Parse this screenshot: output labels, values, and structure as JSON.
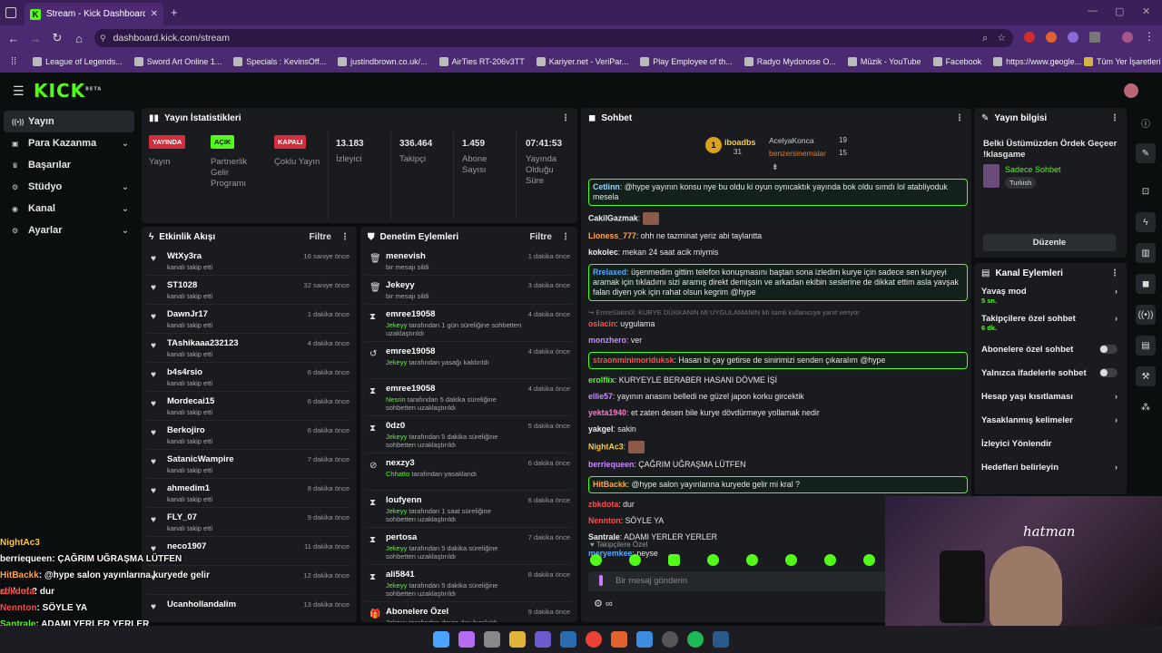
{
  "browser": {
    "tab_title": "Stream - Kick Dashboard",
    "url": "dashboard.kick.com/stream",
    "bookmarks": [
      "League of Legends...",
      "Sword Art Online 1...",
      "Specials : KevinsOff...",
      "justindbrown.co.uk/...",
      "AirTies RT-206v3TT",
      "Kariyer.net - VeriPar...",
      "Play Employee of th...",
      "Radyo Mydonose O...",
      "Müzik - YouTube",
      "Facebook",
      "https://www.google..."
    ],
    "all_bookmarks": "Tüm Yer İşaretleri"
  },
  "app": {
    "logo": "KICK",
    "logo_sup": "BETA"
  },
  "sidebar": {
    "items": [
      {
        "label": "Yayın",
        "chev": false
      },
      {
        "label": "Para Kazanma",
        "chev": true
      },
      {
        "label": "Başarılar",
        "chev": false
      },
      {
        "label": "Stüdyo",
        "chev": true
      },
      {
        "label": "Kanal",
        "chev": true
      },
      {
        "label": "Ayarlar",
        "chev": true
      }
    ]
  },
  "stats": {
    "title": "Yayın İstatistikleri",
    "s1": {
      "badge": "YAYINDA",
      "label": "Yayın"
    },
    "s2": {
      "badge": "AÇIK",
      "label": "Partnerlik Gelir Programı"
    },
    "s3": {
      "badge": "KAPALI",
      "label": "Çoklu Yayın"
    },
    "s4": {
      "value": "13.183",
      "label": "İzleyici"
    },
    "s5": {
      "value": "336.464",
      "label": "Takipçi"
    },
    "s6": {
      "value": "1.459",
      "label": "Abone Sayısı"
    },
    "s7": {
      "value": "07:41:53",
      "label": "Yayında Olduğu Süre"
    }
  },
  "activity": {
    "title": "Etkinlik Akışı",
    "filter": "Filtre",
    "rows": [
      {
        "name": "WtXy3ra",
        "sub": "kanalı takip etti",
        "time": "16 saniye önce"
      },
      {
        "name": "ST1028",
        "sub": "kanalı takip etti",
        "time": "32 saniye önce"
      },
      {
        "name": "DawnJr17",
        "sub": "kanalı takip etti",
        "time": "1 dakika önce"
      },
      {
        "name": "TAshikaaa232123",
        "sub": "kanalı takip etti",
        "time": "4 dakika önce"
      },
      {
        "name": "b4s4rsio",
        "sub": "kanalı takip etti",
        "time": "6 dakika önce"
      },
      {
        "name": "Mordecai15",
        "sub": "kanalı takip etti",
        "time": "6 dakika önce"
      },
      {
        "name": "Berkojiro",
        "sub": "kanalı takip etti",
        "time": "6 dakika önce"
      },
      {
        "name": "SatanicWampire",
        "sub": "kanalı takip etti",
        "time": "7 dakika önce"
      },
      {
        "name": "ahmedim1",
        "sub": "kanalı takip etti",
        "time": "8 dakika önce"
      },
      {
        "name": "FLY_07",
        "sub": "kanalı takip etti",
        "time": "9 dakika önce"
      },
      {
        "name": "neco1907",
        "sub": "",
        "time": "11 dakika önce"
      },
      {
        "name": "",
        "sub": "",
        "time": "12 dakika önce"
      },
      {
        "name": "Ucanhollandalim",
        "sub": "",
        "time": "13 dakika önce"
      }
    ]
  },
  "moderation": {
    "title": "Denetim Eylemleri",
    "filter": "Filtre",
    "rows": [
      {
        "icon": "trash",
        "name": "menevish",
        "sub": "bir mesajı sildi",
        "mod": "",
        "time": "1 dakika önce"
      },
      {
        "icon": "trash",
        "name": "Jekeyy",
        "sub": "bir mesajı sildi",
        "mod": "",
        "time": "3 dakika önce"
      },
      {
        "icon": "hourglass",
        "name": "emree19058",
        "mod": "Jekeyy",
        "sub": " tarafından 1 gün süreliğine sohbetten uzaklaştırıldı",
        "time": "4 dakika önce"
      },
      {
        "icon": "undo",
        "name": "emree19058",
        "mod": "Jekeyy",
        "sub": " tarafından yasağı kaldırıldı",
        "time": "4 dakika önce"
      },
      {
        "icon": "hourglass",
        "name": "emree19058",
        "mod": "Nesrin",
        "sub": " tarafından 5 dakika süreliğine sohbetten uzaklaştırıldı",
        "time": "4 dakika önce"
      },
      {
        "icon": "hourglass",
        "name": "0dz0",
        "mod": "Jekeyy",
        "sub": " tarafından 5 dakika süreliğine sohbetten uzaklaştırıldı",
        "time": "5 dakika önce"
      },
      {
        "icon": "ban",
        "name": "nexzy3",
        "mod": "Chhatto",
        "sub": " tarafından yasaklandı",
        "time": "6 dakika önce"
      },
      {
        "icon": "hourglass",
        "name": "loufyenn",
        "mod": "Jekeyy",
        "sub": " tarafından 1 saat süreliğine sohbetten uzaklaştırıldı",
        "time": "6 dakika önce"
      },
      {
        "icon": "hourglass",
        "name": "pertosa",
        "mod": "Jekeyy",
        "sub": " tarafından 5 dakika süreliğine sohbetten uzaklaştırıldı",
        "time": "7 dakika önce"
      },
      {
        "icon": "hourglass",
        "name": "ali5841",
        "mod": "Jekeyy",
        "sub": " tarafından 5 dakika süreliğine sohbetten uzaklaştırıldı",
        "time": "8 dakika önce"
      },
      {
        "icon": "gift",
        "name": "Abonelere Özel",
        "mod": "Jekeyy",
        "sub": " tarafından devre dışı bırakıldı",
        "time": "9 dakika önce"
      }
    ]
  },
  "chat": {
    "title": "Sohbet",
    "top": {
      "first": "iboadbs",
      "first_count": "31",
      "second": "AcelyaKonca",
      "second_count": "19",
      "third": "benzersinemalar",
      "third_count": "15"
    },
    "messages": [
      {
        "user": "Cetlinn",
        "color": "#9ad6ff",
        "text": "@hype yayının konsu nye bu oldu ki oyun oynıcaktık yayında bok oldu sımdı lol atabliyoduk mesela",
        "hl": true
      },
      {
        "user": "CakilGazmak",
        "color": "#f0f0f0",
        "text": "",
        "hl": false
      },
      {
        "user": "Lioness_777",
        "color": "#ffa64d",
        "text": "ohh ne tazminat yeriz abi taylantta",
        "hl": false
      },
      {
        "user": "kokolec",
        "color": "#f0f0f0",
        "text": "mekan 24 saat acik miymis",
        "hl": false
      },
      {
        "user": "Rrelaxed",
        "color": "#5aa9ff",
        "text": "üşenmedim gittim telefon konuşmasını baştan sona izledim kurye için sadece sen kuryeyi aramak için tıkladımı sizi aramış direkt demişsin ve arkadan ekibin seslerine de dikkat ettim asla yavşak falan diyen yok için rahat olsun kegrim @hype",
        "hl": true
      },
      {
        "user": "EmreSakin0l",
        "color": "#888888",
        "text": "KURYE DÜKKANIN MI UYGULAMANIN MI isimli kullanıcıya yanıt veriyor",
        "hl": false,
        "reply": true
      },
      {
        "user": "oslacin",
        "color": "#ff4d4d",
        "text": "uygulama",
        "hl": false
      },
      {
        "user": "monzhero",
        "color": "#c78cff",
        "text": "ver",
        "hl": false
      },
      {
        "user": "straonminimoriduksk",
        "color": "#ff4d4d",
        "text": "Hasan bi çay getirse de sinirimizi senden çıkaralım @hype",
        "hl": true
      },
      {
        "user": "erolflix",
        "color": "#53fc18",
        "text": "KURYEYLE BERABER HASANI DÖVME İŞİ",
        "hl": false
      },
      {
        "user": "ellie57",
        "color": "#c78cff",
        "text": "yayının anasını belledi ne güzel japon korku gircektik",
        "hl": false
      },
      {
        "user": "yekta1940",
        "color": "#ff7ac8",
        "text": "et zaten desen bile kurye dövdürmeye yollamak nedir",
        "hl": false
      },
      {
        "user": "yakgel",
        "color": "#f0f0f0",
        "text": "sakin",
        "hl": false
      },
      {
        "user": "NightAc3",
        "color": "#ffcc33",
        "text": "",
        "hl": false
      },
      {
        "user": "berriequeen",
        "color": "#c78cff",
        "text": "ÇAĞRIM UĞRAŞMA LÜTFEN",
        "hl": false
      },
      {
        "user": "HitBackk",
        "color": "#ffa64d",
        "text": "@hype salon yayınlarına kuryede gelir mi kral ?",
        "hl": true
      },
      {
        "user": "zbkdota",
        "color": "#ff4d4d",
        "text": "dur",
        "hl": false
      },
      {
        "user": "Nennton",
        "color": "#ff4d4d",
        "text": "SÖYLE YA",
        "hl": false
      },
      {
        "user": "Santrale",
        "color": "#f0f0f0",
        "text": "ADAMI YERLER YERLER",
        "hl": false
      },
      {
        "user": "meryemkee",
        "color": "#5aa9ff",
        "text": "neyse",
        "hl": false
      }
    ],
    "followers_only": "Takipçilere Özel",
    "input_placeholder": "Bir mesaj gönderin",
    "infinity": "∞"
  },
  "stream_info": {
    "title": "Yayın bilgisi",
    "stream_title": "Belki Üstümüzden Ördek Geçeer !klasgame",
    "category": "Sadece Sohbet",
    "tag": "Turkish",
    "edit_button": "Düzenle"
  },
  "channel_actions": {
    "title": "Kanal Eylemleri",
    "rows": [
      {
        "label": "Yavaş mod",
        "sub": "5 sn.",
        "ctrl": "chev"
      },
      {
        "label": "Takipçilere özel sohbet",
        "sub": "6 dk.",
        "ctrl": "chev"
      },
      {
        "label": "Abonelere özel sohbet",
        "sub": "",
        "ctrl": "toggle"
      },
      {
        "label": "Yalnızca ifadelerle sohbet",
        "sub": "",
        "ctrl": "toggle"
      },
      {
        "label": "Hesap yaşı kısıtlaması",
        "sub": "",
        "ctrl": "chev"
      },
      {
        "label": "Yasaklanmış kelimeler",
        "sub": "",
        "ctrl": "chev"
      },
      {
        "label": "İzleyici Yönlendir",
        "sub": "",
        "ctrl": ""
      },
      {
        "label": "Hedefleri belirleyin",
        "sub": "",
        "ctrl": "chev"
      }
    ]
  },
  "overlay": [
    {
      "user": "NightAc3",
      "color": "#ffcc33",
      "text": ""
    },
    {
      "user": "berriequeen",
      "color": "#fff",
      "text": ": ÇAĞRIM UĞRAŞMA LÜTFEN"
    },
    {
      "user": "HitBackk",
      "color": "#ffa64d",
      "text": ": @hype salon yayınlarına kuryede gelir mi kral ?"
    },
    {
      "user": "zbkdota",
      "color": "#ff4d4d",
      "text": ": dur"
    },
    {
      "user": "Nennton",
      "color": "#ff4d4d",
      "text": ": SÖYLE YA"
    },
    {
      "user": "Santrale",
      "color": "#53fc18",
      "text": ": ADAMI YERLER YERLER"
    },
    {
      "user": "meryemkee",
      "color": "#5aa9ff",
      "text": ": neyse"
    }
  ],
  "webcam": {
    "caption": "hatman"
  },
  "colors": {
    "accent": "#53fc18",
    "panel": "#191b1f",
    "bg": "#0b0e0f",
    "browser": "#4b2a72"
  }
}
